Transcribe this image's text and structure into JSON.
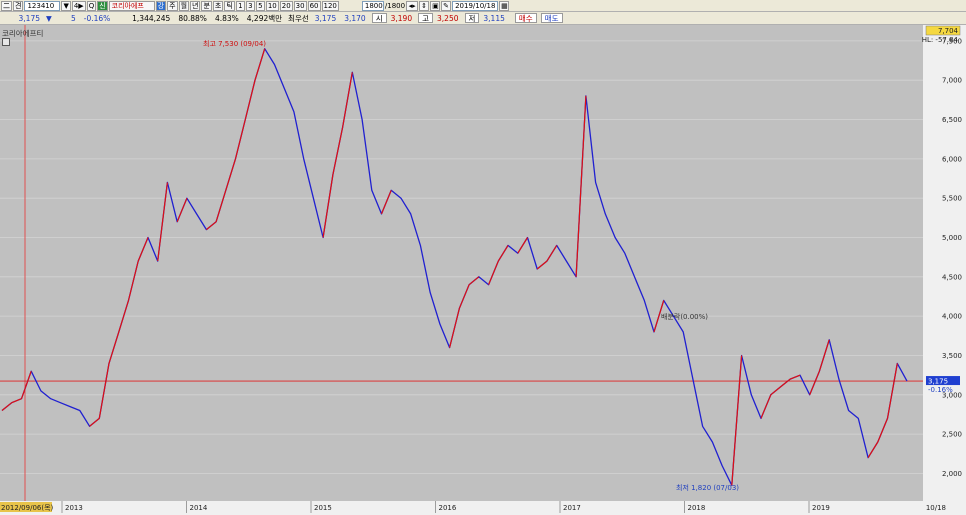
{
  "toolbar": {
    "code": "123410",
    "name": "코리아에프",
    "buttons": [
      "二",
      "견",
      "▼",
      "4▶",
      "Q",
      "신",
      "강",
      "주",
      "월",
      "년",
      "분",
      "초",
      "틱",
      "1",
      "3",
      "5",
      "10",
      "20",
      "30",
      "60",
      "120"
    ],
    "count": "1800",
    "count_total": "/1800",
    "date": "2019/10/18"
  },
  "quote": {
    "price": "3,175",
    "change": "5",
    "change_pct": "-0.16%",
    "volume": "1,344,245",
    "turnover_pct": "80.88%",
    "rate": "4.83%",
    "amount": "4,292백만",
    "pref_label": "최우선",
    "ask": "3,175",
    "bid": "3,170",
    "open_label": "시",
    "open": "3,190",
    "high_label": "고",
    "high": "3,250",
    "low_label": "저",
    "low": "3,115",
    "buy_label": "매수",
    "sell_label": "매도"
  },
  "chart_title": "코리아에프티",
  "chart_data": {
    "type": "line",
    "x_labels": [
      "2013",
      "2014",
      "2015",
      "2016",
      "2017",
      "2018",
      "2019"
    ],
    "x_start_label": "2012/09/06(목)",
    "x_end_label": "10/18",
    "y_ticks": [
      "7,500",
      "7,000",
      "6,500",
      "6,000",
      "5,500",
      "5,000",
      "4,500",
      "4,000",
      "3,500",
      "3,000",
      "2,500",
      "2,000"
    ],
    "ylim": [
      1650,
      7600
    ],
    "current_price_label": "3,175",
    "current_change_label": "-0.16%",
    "top_box_label": "7,704",
    "top_box_sub": "HL: -57.84",
    "annotations": {
      "high": "최고 7,530 (09/04)",
      "low": "최저 1,820 (07/03)",
      "ref": "배분락(0.00%)"
    },
    "series": [
      {
        "values": [
          2800,
          2900,
          2950,
          3300,
          3050,
          2950,
          2900,
          2850,
          2800,
          2600,
          2700,
          3400,
          3800,
          4200,
          4700,
          5000,
          4700,
          5700,
          5200,
          5500,
          5300,
          5100,
          5200,
          5600,
          6000,
          6500,
          7000,
          7400,
          7200,
          6900,
          6600,
          6000,
          5500,
          5000,
          5800,
          6400,
          7100,
          6500,
          5600,
          5300,
          5600,
          5500,
          5300,
          4900,
          4300,
          3900,
          3600,
          4100,
          4400,
          4500,
          4400,
          4700,
          4900,
          4800,
          5000,
          4600,
          4700,
          4900,
          4700,
          4500,
          6800,
          5700,
          5300,
          5000,
          4800,
          4500,
          4200,
          3800,
          4200,
          4000,
          3800,
          3200,
          2600,
          2400,
          2100,
          1850,
          3500,
          3000,
          2700,
          3000,
          3100,
          3200,
          3250,
          3000,
          3300,
          3700,
          3200,
          2800,
          2700,
          2200,
          2400,
          2700,
          3400,
          3175
        ]
      }
    ]
  }
}
